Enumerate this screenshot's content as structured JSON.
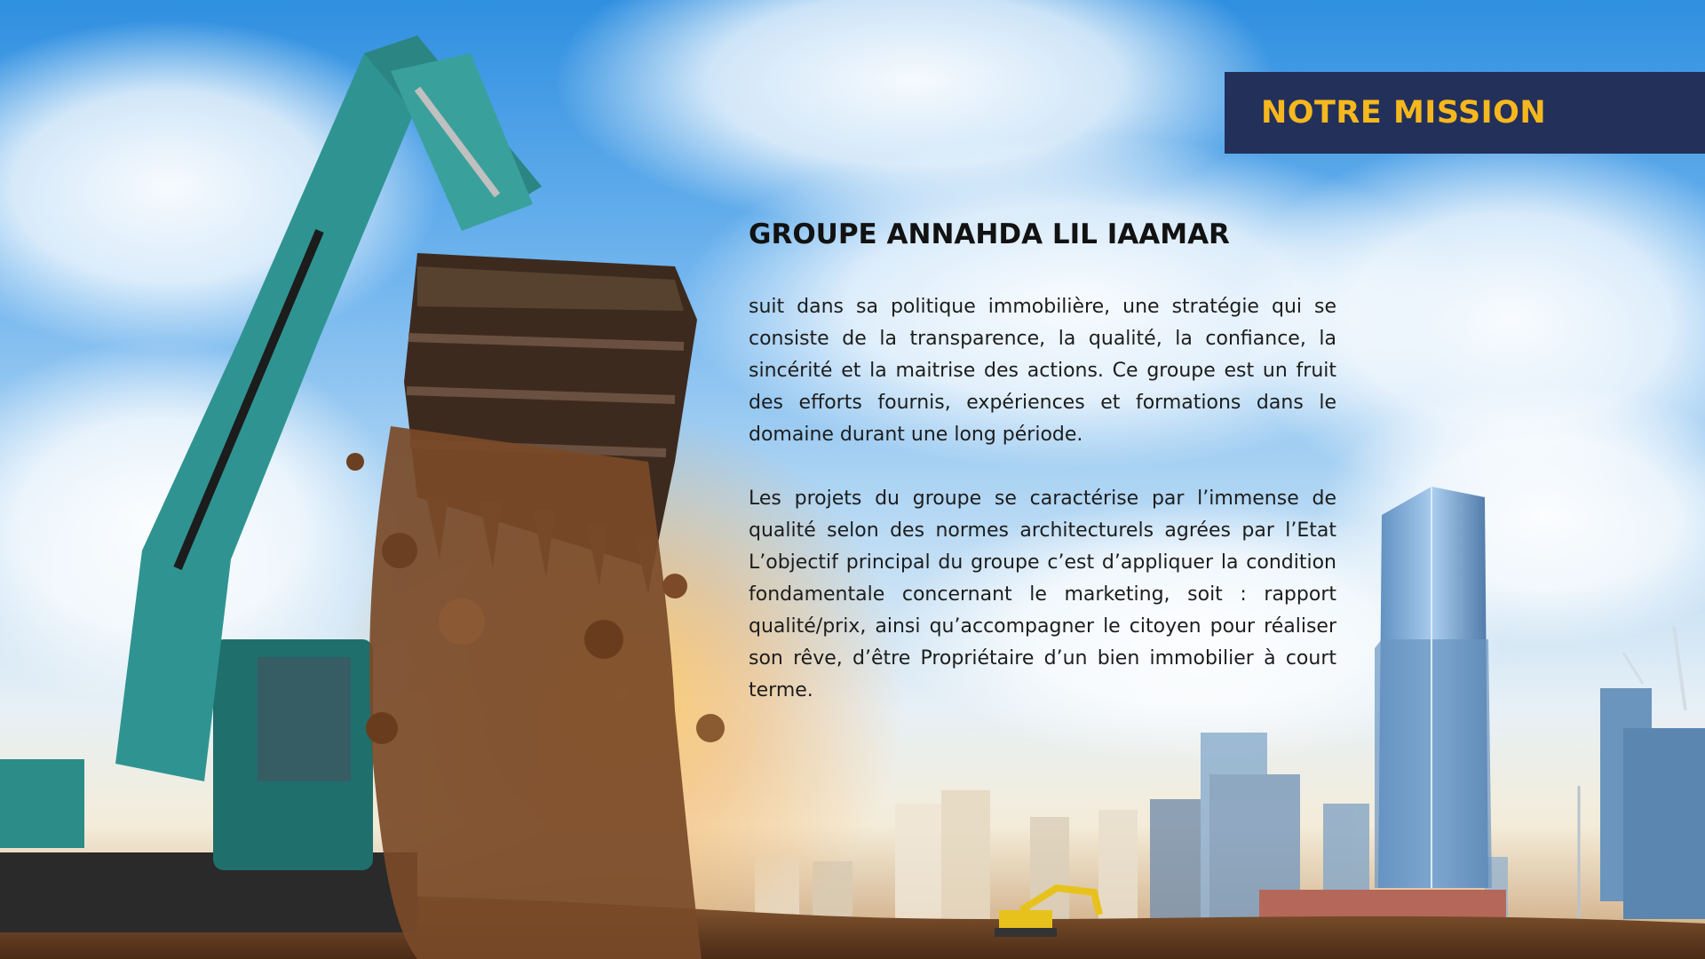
{
  "banner": {
    "title": "NOTRE MISSION"
  },
  "content": {
    "company_name": "GROUPE ANNAHDA LIL IAAMAR",
    "paragraphs": [
      "suit dans sa politique immobilière, une stratégie qui se consiste de la transparence, la qualité, la confiance, la sincérité et la maitrise des actions. Ce groupe est un fruit des efforts fournis, expériences et formations dans le domaine durant une long période.",
      "Les projets du groupe se caractérise par l’immense de qualité selon des normes architecturels agrées par l’Etat L’objectif principal du groupe c’est d’appliquer la condition fondamentale concernant le marketing, soit : rapport qualité/prix, ainsi qu’accompagner le citoyen pour réaliser son rêve, d’être Propriétaire d’un bien immobilier à court terme."
    ]
  },
  "colors": {
    "banner_background": "#23305a",
    "banner_text": "#f6b81e",
    "body_text": "#1d1d1d",
    "sky_top": "#2f8fe0",
    "excavator": "#2f8f8c",
    "soil": "#7a4a28"
  },
  "background": {
    "icons": [
      "excavator-icon",
      "skyline-icon",
      "crane-icon"
    ]
  }
}
